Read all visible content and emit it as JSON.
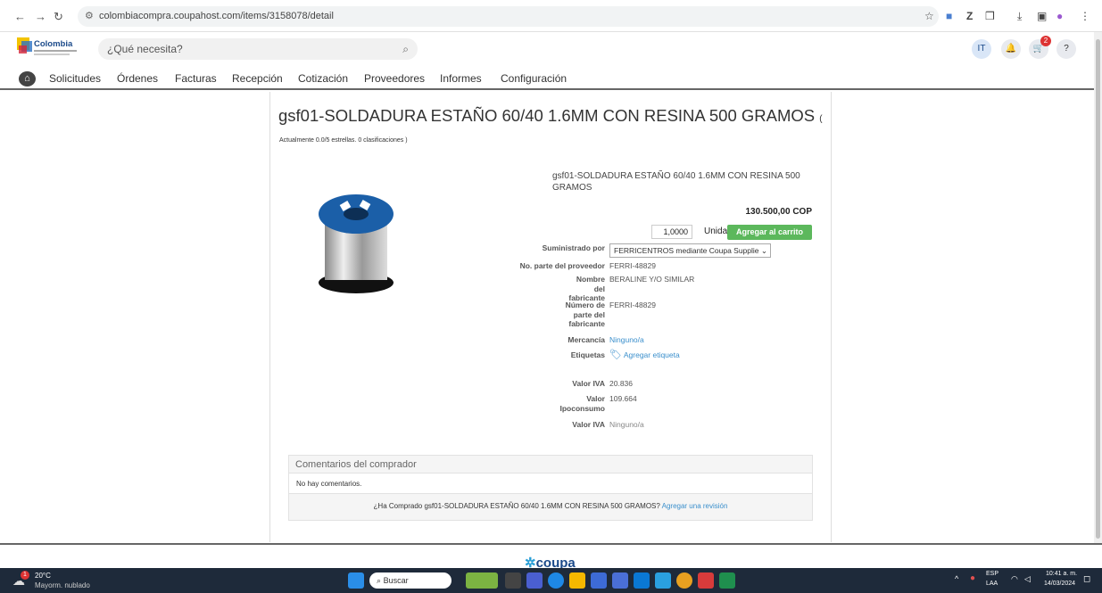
{
  "browser": {
    "url": "colombiacompra.coupahost.com/items/3158078/detail"
  },
  "header": {
    "logo_text": "Colombia",
    "search_placeholder": "¿Qué necesita?",
    "user_initials": "IT",
    "cart_count": "2",
    "help": "?"
  },
  "nav": {
    "items": [
      "Solicitudes",
      "Órdenes",
      "Facturas",
      "Recepción",
      "Cotización",
      "Proveedores",
      "Informes",
      "Configuración"
    ]
  },
  "product": {
    "title": "gsf01-SOLDADURA ESTAÑO 60/40 1.6MM CON RESINA 500 GRAMOS",
    "title_suffix": "(",
    "rating": "Actualmente 0.0/5 estrellas. 0 clasificaciones )",
    "name": "gsf01-SOLDADURA ESTAÑO 60/40 1.6MM CON RESINA 500 GRAMOS",
    "price": "130.500,00 COP",
    "quantity": "1,0000",
    "unit": "Unidad",
    "add_button": "Agregar al carrito",
    "supplier_label": "Suministrado por",
    "supplier_value": "FERRICENTROS mediante Coupa Supplier",
    "part_label": "No. parte del proveedor",
    "part_value": "FERRI-48829",
    "manufacturer_label": "Nombre del fabricante",
    "manufacturer_value": "BERALINE Y/O SIMILAR",
    "mfr_part_label": "Número de parte del fabricante",
    "mfr_part_value": "FERRI-48829",
    "commodity_label": "Mercancía",
    "commodity_value": "Ninguno/a",
    "tags_label": "Etiquetas",
    "tags_value": "Agregar etiqueta",
    "iva_label": "Valor IVA",
    "iva_value": "20.836",
    "ipo_label": "Valor Ipoconsumo",
    "ipo_value": "109.664",
    "iva2_label": "Valor IVA",
    "iva2_value": "Ninguno/a"
  },
  "comments": {
    "heading": "Comentarios del comprador",
    "empty": "No hay comentarios.",
    "question": "¿Ha Comprado gsf01-SOLDADURA ESTAÑO 60/40 1.6MM CON RESINA 500 GRAMOS?",
    "review_link": "Agregar una revisión"
  },
  "footer": {
    "brand": "coupa"
  },
  "taskbar": {
    "weather_temp": "20°C",
    "weather_desc": "Mayorm. nublado",
    "search": "Buscar",
    "lang": "ESP",
    "lang2": "LAA",
    "time": "10:41 a. m.",
    "date": "14/03/2024",
    "weather_badge": "1"
  },
  "colors": {
    "add_button": "#5cb85c",
    "link": "#3a8fcc",
    "taskbar": "#1e2a3a"
  }
}
